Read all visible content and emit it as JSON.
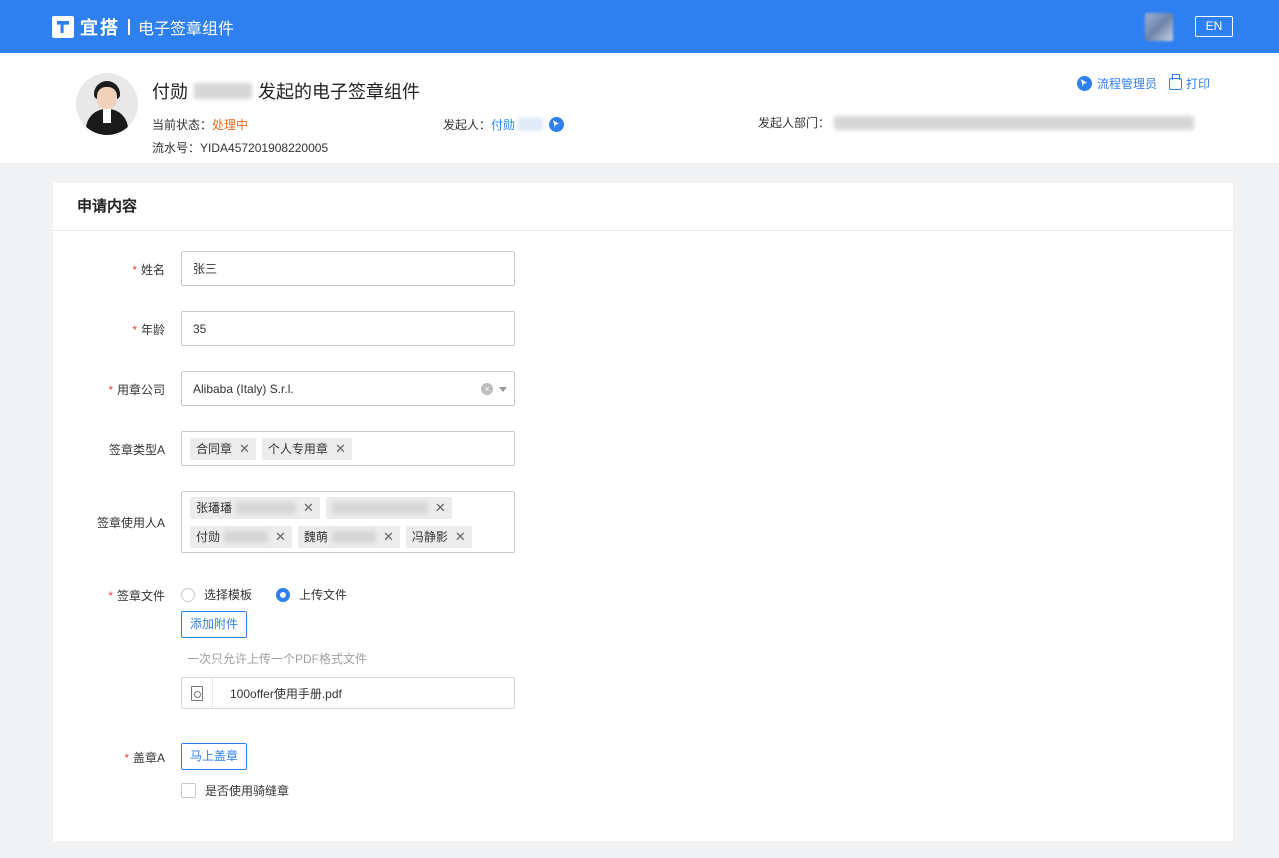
{
  "topbar": {
    "logo_text": "宜搭",
    "app_title": "电子签章组件",
    "lang_button": "EN"
  },
  "header": {
    "title_prefix": "付勋",
    "title_suffix": "发起的电子签章组件",
    "status_label": "当前状态：",
    "status_value": "处理中",
    "serial_label": "流水号：",
    "serial_value": "YIDA457201908220005",
    "initiator_label": "发起人：",
    "initiator_value": "付勋",
    "dept_label": "发起人部门：",
    "flow_admin_link": "流程管理员",
    "print_link": "打印"
  },
  "form": {
    "section_title": "申请内容",
    "name": {
      "label": "姓名",
      "value": "张三"
    },
    "age": {
      "label": "年龄",
      "value": "35"
    },
    "company": {
      "label": "用章公司",
      "value": "Alibaba (Italy) S.r.l."
    },
    "seal_type": {
      "label": "签章类型A",
      "tags": [
        "合同章",
        "个人专用章"
      ]
    },
    "seal_users": {
      "label": "签章使用人A",
      "tags": [
        "张璠璠",
        "付勋",
        "魏萌",
        "冯静影"
      ]
    },
    "seal_file": {
      "label": "签章文件",
      "option_template": "选择模板",
      "option_upload": "上传文件",
      "add_attachment": "添加附件",
      "hint": "一次只允许上传一个PDF格式文件",
      "file_name": "100offer使用手册.pdf"
    },
    "stamp": {
      "label": "盖章A",
      "button": "马上盖章",
      "checkbox_label": "是否使用骑缝章"
    }
  },
  "colors": {
    "brand": "#2e7ff0",
    "status_orange": "#ea6a1d",
    "required_red": "#f03d3d"
  }
}
